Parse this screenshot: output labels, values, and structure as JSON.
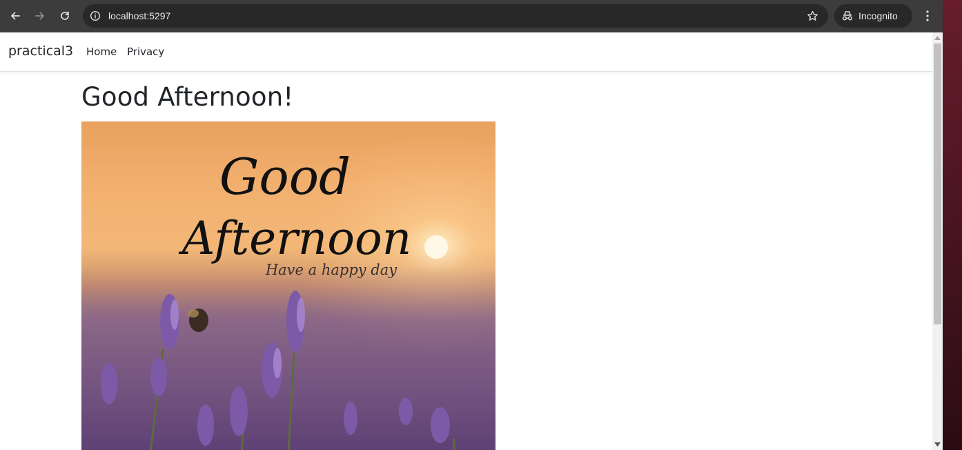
{
  "browser": {
    "url": "localhost:5297",
    "mode_label": "Incognito",
    "icons": {
      "back": "arrow-left-icon",
      "forward": "arrow-right-icon",
      "reload": "reload-icon",
      "site_info": "info-icon",
      "bookmark": "star-icon",
      "incognito": "incognito-icon",
      "menu": "kebab-menu-icon"
    }
  },
  "navbar": {
    "brand": "practical3",
    "links": [
      {
        "label": "Home"
      },
      {
        "label": "Privacy"
      }
    ]
  },
  "main": {
    "heading": "Good Afternoon!",
    "image": {
      "line1": "Good",
      "line2": "Afternoon",
      "line3": "Have a happy day"
    }
  },
  "colors": {
    "toolbar": "#3c3c3c",
    "omnibox": "#282828",
    "text_dark": "#212529"
  }
}
